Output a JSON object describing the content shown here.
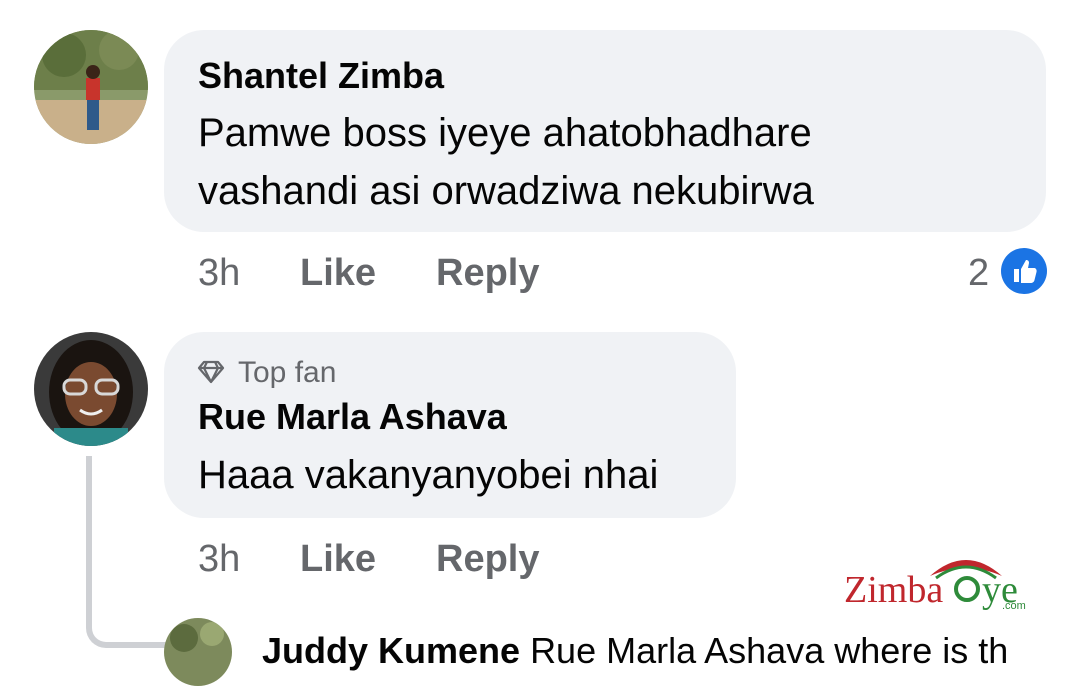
{
  "comments": [
    {
      "author": "Shantel Zimba",
      "text_line1": "Pamwe boss iyeye ahatobhadhare",
      "text_line2": "vashandi asi orwadziwa nekubirwa",
      "time": "3h",
      "like_label": "Like",
      "reply_label": "Reply",
      "reaction_count": "2"
    },
    {
      "badge": "Top fan",
      "author": "Rue Marla Ashava",
      "text": "Haaa vakanyanyobei nhai",
      "time": "3h",
      "like_label": "Like",
      "reply_label": "Reply"
    }
  ],
  "reply_preview": {
    "author": "Juddy Kumene",
    "text": "Rue Marla Ashava where is th"
  },
  "watermark": {
    "brand": "Zimba",
    "suffix": "ye",
    "domain": ".com"
  },
  "colors": {
    "bubble": "#f0f2f5",
    "secondary_text": "#65676b",
    "like_blue": "#1b74e4",
    "watermark_red": "#c0272d",
    "watermark_green": "#2e8b3a"
  }
}
